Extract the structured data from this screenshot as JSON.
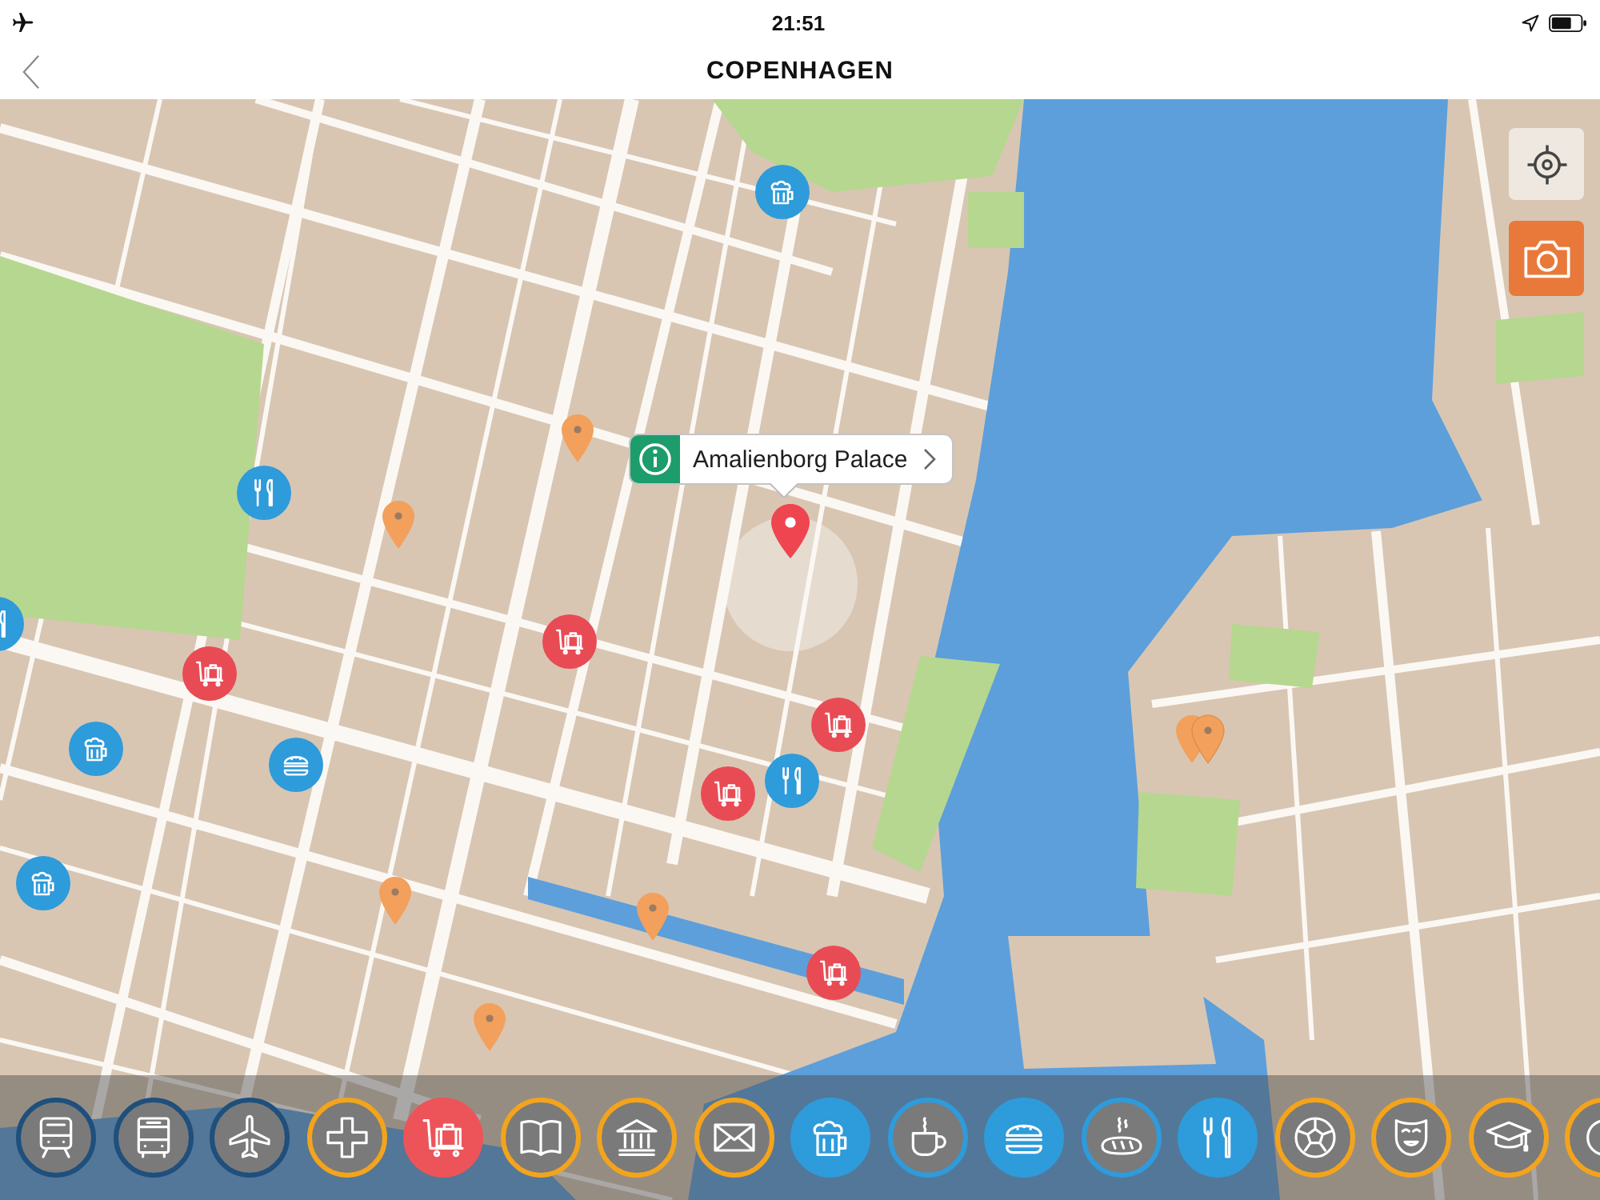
{
  "status_bar": {
    "time": "21:51"
  },
  "nav_bar": {
    "title": "COPENHAGEN"
  },
  "map": {
    "selected_place": {
      "title": "Amalienborg Palace"
    },
    "markers": [
      {
        "kind": "beer",
        "color": "#2e9bdb"
      },
      {
        "kind": "cutlery",
        "color": "#2e9bdb"
      },
      {
        "kind": "cutlery",
        "color": "#2e9bdb"
      },
      {
        "kind": "luggage",
        "color": "#e94b55"
      },
      {
        "kind": "luggage",
        "color": "#e94b55"
      },
      {
        "kind": "beer",
        "color": "#2e9bdb"
      },
      {
        "kind": "burger",
        "color": "#2e9bdb"
      },
      {
        "kind": "luggage",
        "color": "#e94b55"
      },
      {
        "kind": "luggage",
        "color": "#e94b55"
      },
      {
        "kind": "cutlery",
        "color": "#2e9bdb"
      },
      {
        "kind": "beer",
        "color": "#2e9bdb"
      },
      {
        "kind": "luggage",
        "color": "#e94b55"
      },
      {
        "kind": "pin",
        "color": "#f2a05c"
      },
      {
        "kind": "pin",
        "color": "#f2a05c"
      },
      {
        "kind": "pin",
        "color": "#f2a05c"
      },
      {
        "kind": "pin",
        "color": "#f2a05c"
      },
      {
        "kind": "pin",
        "color": "#f2a05c"
      },
      {
        "kind": "pin_pair",
        "color": "#f2a05c"
      }
    ]
  },
  "categories": [
    {
      "kind": "train",
      "color": "#1e4f7d",
      "selected": false
    },
    {
      "kind": "bus",
      "color": "#1e4f7d",
      "selected": false
    },
    {
      "kind": "plane",
      "color": "#1e4f7d",
      "selected": false
    },
    {
      "kind": "plus",
      "color": "#f3a41c",
      "selected": false
    },
    {
      "kind": "luggage",
      "color": "#ec5459",
      "selected": true
    },
    {
      "kind": "book",
      "color": "#f3a41c",
      "selected": false
    },
    {
      "kind": "bank",
      "color": "#f3a41c",
      "selected": false
    },
    {
      "kind": "mail",
      "color": "#f3a41c",
      "selected": false
    },
    {
      "kind": "beer",
      "color": "#2e9bdb",
      "selected": true
    },
    {
      "kind": "coffee",
      "color": "#2e9bdb",
      "selected": false
    },
    {
      "kind": "burger",
      "color": "#2e9bdb",
      "selected": true
    },
    {
      "kind": "bread",
      "color": "#2e9bdb",
      "selected": false
    },
    {
      "kind": "cutlery",
      "color": "#2e9bdb",
      "selected": true
    },
    {
      "kind": "football",
      "color": "#f3a41c",
      "selected": false
    },
    {
      "kind": "mask",
      "color": "#f3a41c",
      "selected": false
    },
    {
      "kind": "cap",
      "color": "#f3a41c",
      "selected": false
    },
    {
      "kind": "other",
      "color": "#f3a41c",
      "selected": false
    }
  ]
}
